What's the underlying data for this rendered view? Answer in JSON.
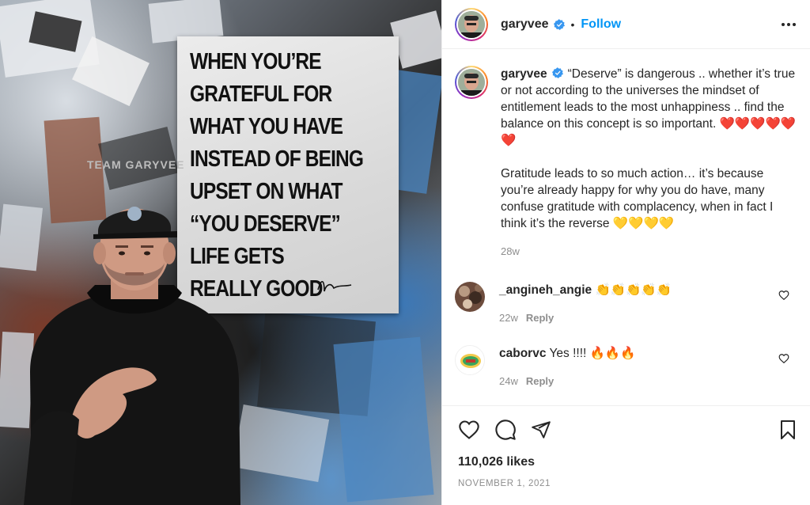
{
  "post": {
    "username": "garyvee",
    "follow_label": "Follow",
    "dot": "•"
  },
  "poster": {
    "lines": [
      "WHEN YOU’RE",
      "GRATEFUL FOR",
      "WHAT YOU HAVE",
      "INSTEAD OF BEING",
      "UPSET ON WHAT",
      "“YOU DESERVE”",
      "LIFE GETS",
      "REALLY GOOD"
    ],
    "shirt_text": "TEAM GARYVEE"
  },
  "caption": {
    "username": "garyvee",
    "text": "“Deserve” is dangerous .. whether it’s true or not according to the universes the mindset of entitlement leads to the most unhappiness .. find the balance on this concept is so important. ❤️❤️❤️❤️❤️❤️\n\nGratitude leads to so much action… it’s because you’re already happy for why you do have, many confuse gratitude with complacency, when in fact I think it’s the reverse 💛💛💛💛",
    "age": "28w"
  },
  "comments": [
    {
      "username": "_angineh_angie",
      "text": "👏👏👏👏👏",
      "age": "22w",
      "reply_label": "Reply"
    },
    {
      "username": "caborvc",
      "text": "Yes !!!! 🔥🔥🔥",
      "age": "24w",
      "reply_label": "Reply"
    }
  ],
  "likes": "110,026 likes",
  "date": "NOVEMBER 1, 2021",
  "colors": {
    "accent": "#0095f6",
    "muted": "#8e8e8e",
    "text": "#262626",
    "verified": "#3897f0"
  },
  "icons": [
    "verified-icon",
    "more-icon",
    "heart-icon",
    "comment-icon",
    "share-icon",
    "bookmark-icon"
  ]
}
